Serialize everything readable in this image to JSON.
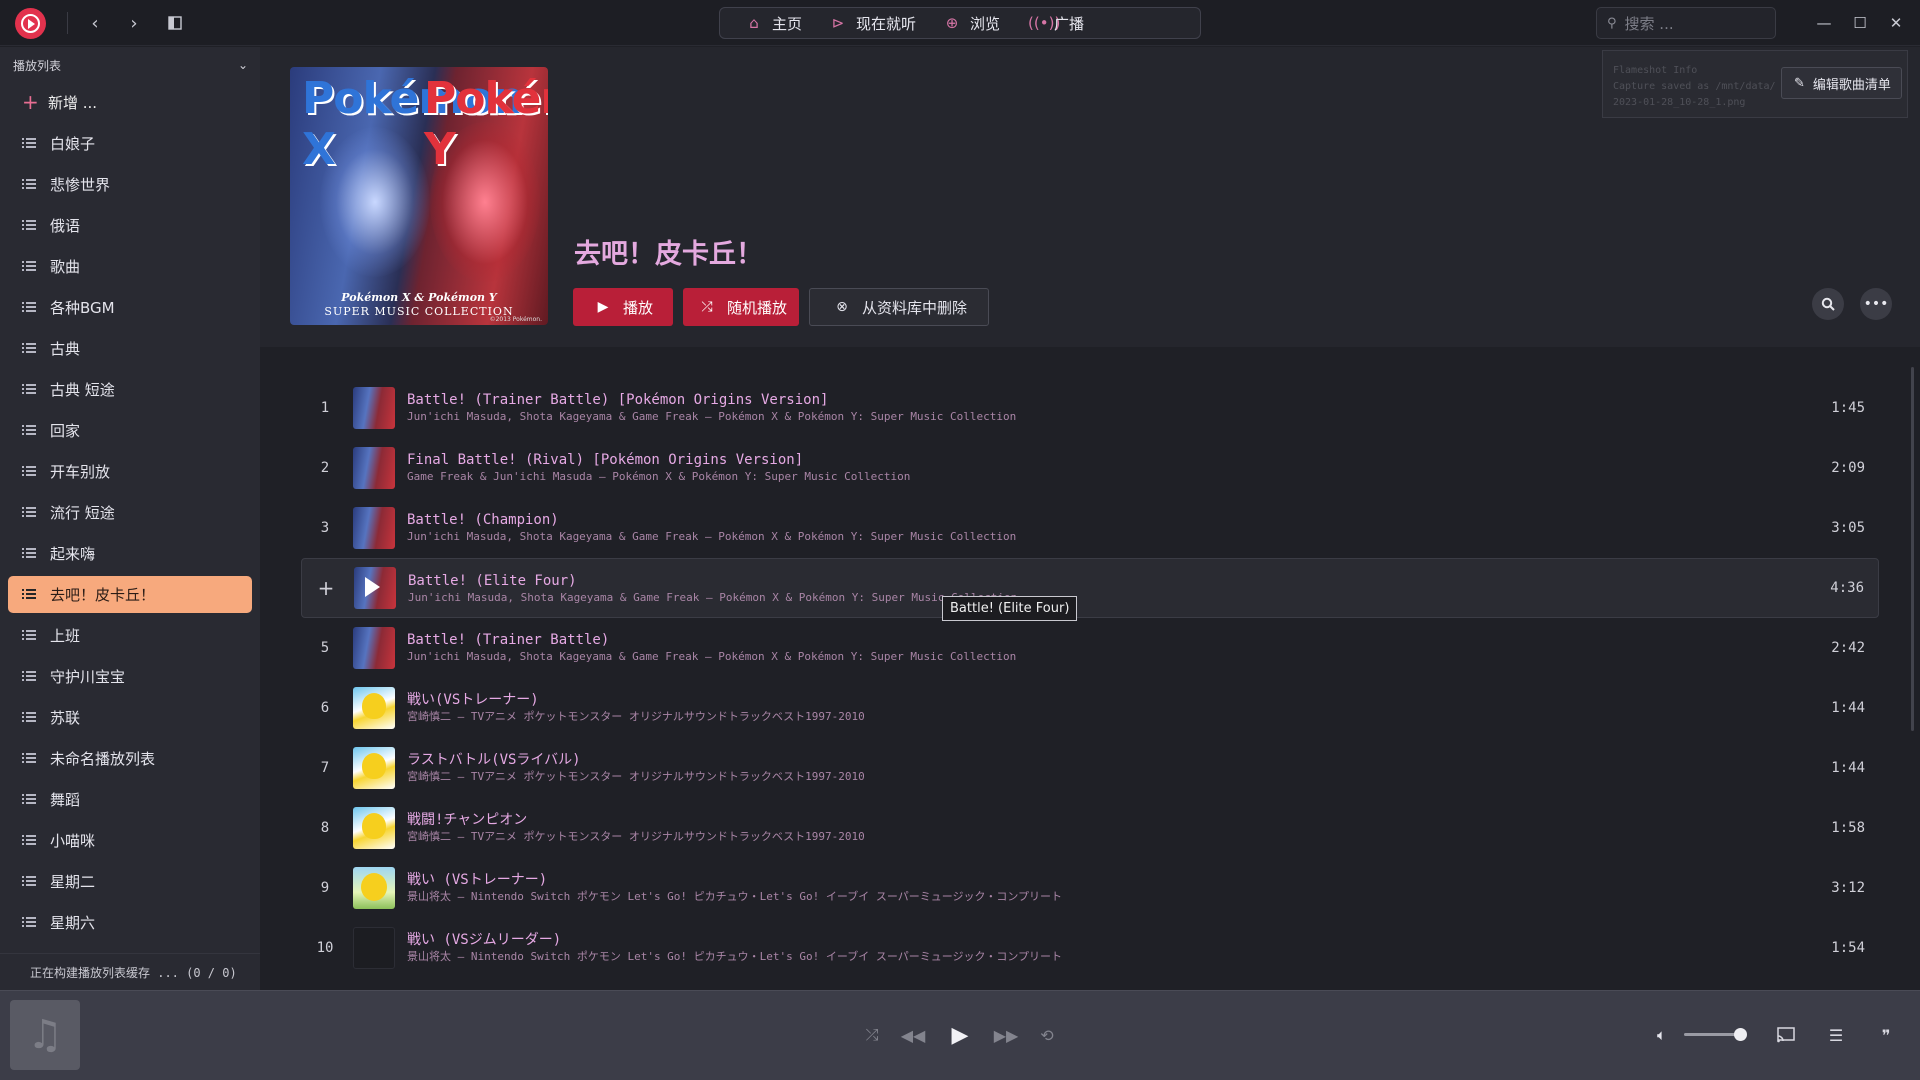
{
  "app": {
    "accent": "#e2324d"
  },
  "nav": {
    "tabs": [
      {
        "label": "主页",
        "icon": "home-icon"
      },
      {
        "label": "现在就听",
        "icon": "play-circle-icon"
      },
      {
        "label": "浏览",
        "icon": "globe-icon"
      },
      {
        "label": "广播",
        "icon": "radio-icon"
      }
    ]
  },
  "search": {
    "placeholder": "搜索 ..."
  },
  "sidebar": {
    "header": "播放列表",
    "add_label": "新增 ...",
    "items": [
      {
        "label": "白娘子"
      },
      {
        "label": "悲惨世界"
      },
      {
        "label": "俄语"
      },
      {
        "label": "歌曲"
      },
      {
        "label": "各种BGM"
      },
      {
        "label": "古典"
      },
      {
        "label": "古典  短途"
      },
      {
        "label": "回家"
      },
      {
        "label": "开车别放"
      },
      {
        "label": "流行  短途"
      },
      {
        "label": "起来嗨"
      },
      {
        "label": "去吧！皮卡丘！",
        "active": true
      },
      {
        "label": "上班"
      },
      {
        "label": "守护川宝宝"
      },
      {
        "label": "苏联"
      },
      {
        "label": "未命名播放列表"
      },
      {
        "label": "舞蹈"
      },
      {
        "label": "小喵咪"
      },
      {
        "label": "星期二"
      },
      {
        "label": "星期六"
      }
    ],
    "footer_status": "正在构建播放列表缓存 ... (0 / 0)"
  },
  "playlist": {
    "title": "去吧！皮卡丘！",
    "cover": {
      "logo_left": "Pokémon X",
      "logo_right": "Pokémon Y",
      "caption1": "Pokémon X & Pokémon Y",
      "caption2": "SUPER MUSIC COLLECTION",
      "copyright": "©2013 Pokémon."
    },
    "buttons": {
      "play": "播放",
      "shuffle": "随机播放",
      "remove": "从资料库中删除",
      "edit": "编辑歌曲清单"
    }
  },
  "flameshot": {
    "line1": "Flameshot Info",
    "line2": "Capture saved as /mnt/data/",
    "line3": "2023-01-28_10-28_1.png"
  },
  "tracks": [
    {
      "num": "1",
      "title": "Battle! (Trainer Battle) [Pokémon Origins Version]",
      "subtitle": "Jun'ichi Masuda, Shota Kageyama & Game Freak — Pokémon X & Pokémon Y: Super Music Collection",
      "duration": "1:45",
      "art": "xy"
    },
    {
      "num": "2",
      "title": "Final Battle! (Rival) [Pokémon Origins Version]",
      "subtitle": "Game Freak & Jun'ichi Masuda — Pokémon X & Pokémon Y: Super Music Collection",
      "duration": "2:09",
      "art": "xy"
    },
    {
      "num": "3",
      "title": "Battle! (Champion)",
      "subtitle": "Jun'ichi Masuda, Shota Kageyama & Game Freak — Pokémon X & Pokémon Y: Super Music Collection",
      "duration": "3:05",
      "art": "xy"
    },
    {
      "num": "+",
      "title": "Battle! (Elite Four)",
      "subtitle": "Jun'ichi Masuda, Shota Kageyama & Game Freak — Pokémon X & Pokémon Y: Super Music Collection",
      "duration": "4:36",
      "art": "xy",
      "hover": true
    },
    {
      "num": "5",
      "title": "Battle! (Trainer Battle)",
      "subtitle": "Jun'ichi Masuda, Shota Kageyama & Game Freak — Pokémon X & Pokémon Y: Super Music Collection",
      "duration": "2:42",
      "art": "xy"
    },
    {
      "num": "6",
      "title": "戦い(VSトレーナー)",
      "subtitle": "宮崎慎二 — TVアニメ ポケットモンスター オリジナルサウンドトラックベスト1997-2010",
      "duration": "1:44",
      "art": "pika"
    },
    {
      "num": "7",
      "title": "ラストバトル(VSライバル)",
      "subtitle": "宮崎慎二 — TVアニメ ポケットモンスター オリジナルサウンドトラックベスト1997-2010",
      "duration": "1:44",
      "art": "pika"
    },
    {
      "num": "8",
      "title": "戦闘!チャンピオン",
      "subtitle": "宮崎慎二 — TVアニメ ポケットモンスター オリジナルサウンドトラックベスト1997-2010",
      "duration": "1:58",
      "art": "pika"
    },
    {
      "num": "9",
      "title": "戦い (VSトレーナー)",
      "subtitle": "景山将太 — Nintendo Switch ポケモン Let's Go! ピカチュウ・Let's Go! イーブイ スーパーミュージック・コンプリート",
      "duration": "3:12",
      "art": "letsgo"
    },
    {
      "num": "10",
      "title": "戦い (VSジムリーダー)",
      "subtitle": "景山将太 — Nintendo Switch ポケモン Let's Go! ピカチュウ・Let's Go! イーブイ スーパーミュージック・コンプリート",
      "duration": "1:54",
      "art": "blank"
    }
  ],
  "tooltip": "Battle! (Elite Four)",
  "player": {
    "volume": 0.9
  }
}
